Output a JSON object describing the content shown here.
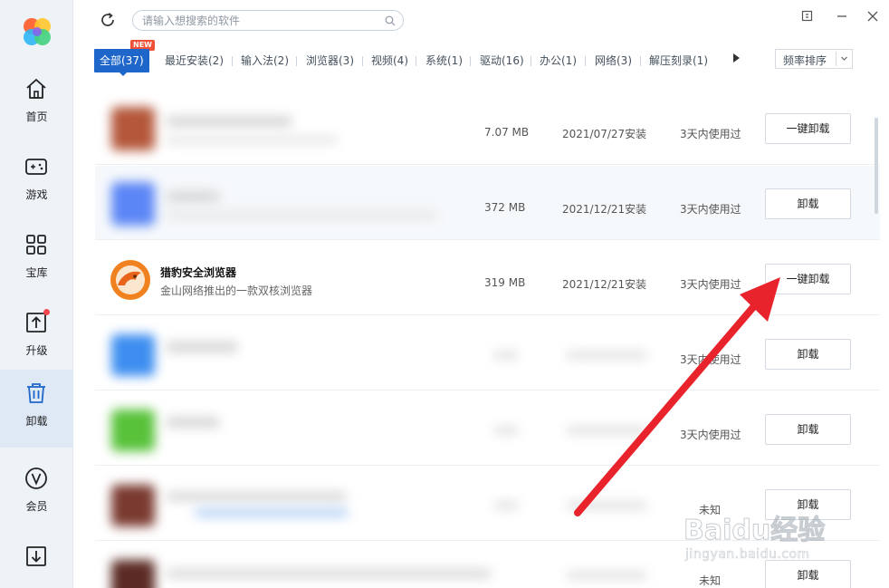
{
  "sidebar": {
    "items": [
      {
        "label": "首页",
        "icon": "home-icon"
      },
      {
        "label": "游戏",
        "icon": "gamepad-icon"
      },
      {
        "label": "宝库",
        "icon": "grid-icon"
      },
      {
        "label": "升级",
        "icon": "upgrade-icon"
      },
      {
        "label": "卸载",
        "icon": "trash-icon"
      },
      {
        "label": "会员",
        "icon": "vip-icon"
      },
      {
        "label": "",
        "icon": "download-icon"
      }
    ],
    "active_index": 4,
    "accent": "#1e66c9"
  },
  "header": {
    "search_placeholder": "请输入想搜索的软件"
  },
  "tabs": {
    "items": [
      "全部(37)",
      "最近安装(2)",
      "输入法(2)",
      "浏览器(3)",
      "视频(4)",
      "系统(1)",
      "驱动(16)",
      "办公(1)",
      "网络(3)",
      "解压刻录(1)"
    ],
    "new_badge": "NEW",
    "sort_label": "频率排序"
  },
  "apps": [
    {
      "name": "",
      "desc": "",
      "size": "7.07 MB",
      "date": "2021/07/27安装",
      "usage": "3天内使用过",
      "action": "一键卸载",
      "obscured": true
    },
    {
      "name": "",
      "desc": "",
      "size": "372 MB",
      "date": "2021/12/21安装",
      "usage": "3天内使用过",
      "action": "卸载",
      "obscured": true
    },
    {
      "name": "猎豹安全浏览器",
      "desc": "金山网络推出的一款双核浏览器",
      "size": "319 MB",
      "date": "2021/12/21安装",
      "usage": "3天内使用过",
      "action": "一键卸载",
      "obscured": false
    },
    {
      "name": "",
      "desc": "",
      "size": "",
      "date": "",
      "usage": "3天内使用过",
      "action": "卸载",
      "obscured": true
    },
    {
      "name": "",
      "desc": "",
      "size": "",
      "date": "",
      "usage": "3天内使用过",
      "action": "卸载",
      "obscured": true
    },
    {
      "name": "",
      "desc": "",
      "size": "",
      "date": "",
      "usage": "未知",
      "action": "卸载",
      "obscured": true
    },
    {
      "name": "",
      "desc": "",
      "size": "",
      "date": "",
      "usage": "未知",
      "action": "卸载",
      "obscured": true
    }
  ],
  "watermark": {
    "brand": "Baidu经验",
    "url": "jingyan.baidu.com"
  },
  "colors": {
    "arrow": "#e8232b",
    "tab_active": "#1e66c9",
    "badge": "#f05136"
  }
}
